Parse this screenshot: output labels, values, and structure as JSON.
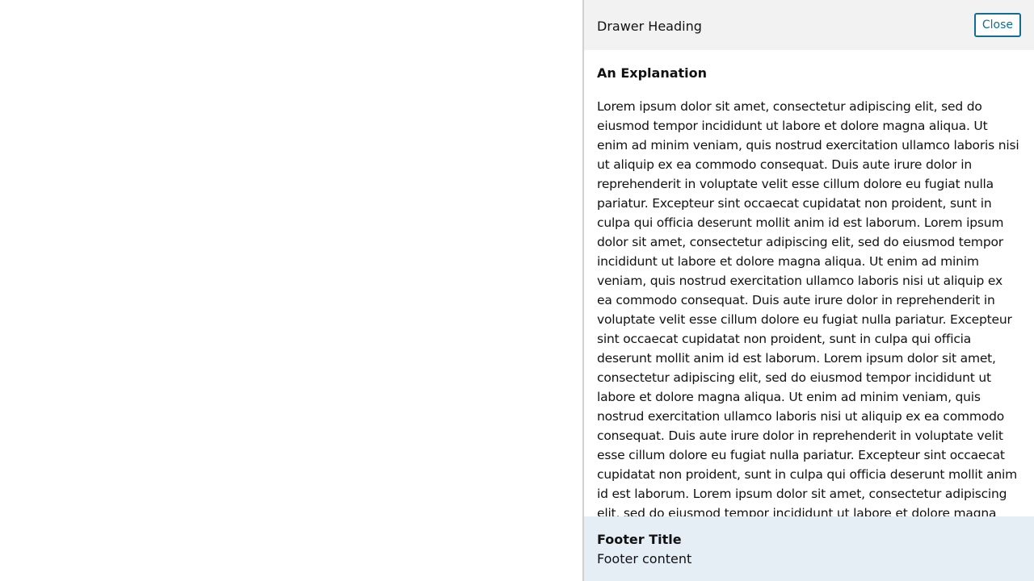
{
  "drawer": {
    "heading": "Drawer Heading",
    "close_label": "Close",
    "section_title": "An Explanation",
    "body_text": "Lorem ipsum dolor sit amet, consectetur adipiscing elit, sed do eiusmod tempor incididunt ut labore et dolore magna aliqua. Ut enim ad minim veniam, quis nostrud exercitation ullamco laboris nisi ut aliquip ex ea commodo consequat. Duis aute irure dolor in reprehenderit in voluptate velit esse cillum dolore eu fugiat nulla pariatur. Excepteur sint occaecat cupidatat non proident, sunt in culpa qui officia deserunt mollit anim id est laborum. Lorem ipsum dolor sit amet, consectetur adipiscing elit, sed do eiusmod tempor incididunt ut labore et dolore magna aliqua. Ut enim ad minim veniam, quis nostrud exercitation ullamco laboris nisi ut aliquip ex ea commodo consequat. Duis aute irure dolor in reprehenderit in voluptate velit esse cillum dolore eu fugiat nulla pariatur. Excepteur sint occaecat cupidatat non proident, sunt in culpa qui officia deserunt mollit anim id est laborum. Lorem ipsum dolor sit amet, consectetur adipiscing elit, sed do eiusmod tempor incididunt ut labore et dolore magna aliqua. Ut enim ad minim veniam, quis nostrud exercitation ullamco laboris nisi ut aliquip ex ea commodo consequat. Duis aute irure dolor in reprehenderit in voluptate velit esse cillum dolore eu fugiat nulla pariatur. Excepteur sint occaecat cupidatat non proident, sunt in culpa qui officia deserunt mollit anim id est laborum. Lorem ipsum dolor sit amet, consectetur adipiscing elit, sed do eiusmod tempor incididunt ut labore et dolore magna aliqua. Ut enim ad minim veniam, quis",
    "footer_title": "Footer Title",
    "footer_content": "Footer content"
  },
  "colors": {
    "accent": "#0e6f93",
    "header_bg": "#f2f2f2",
    "footer_bg": "#e6eef5"
  }
}
